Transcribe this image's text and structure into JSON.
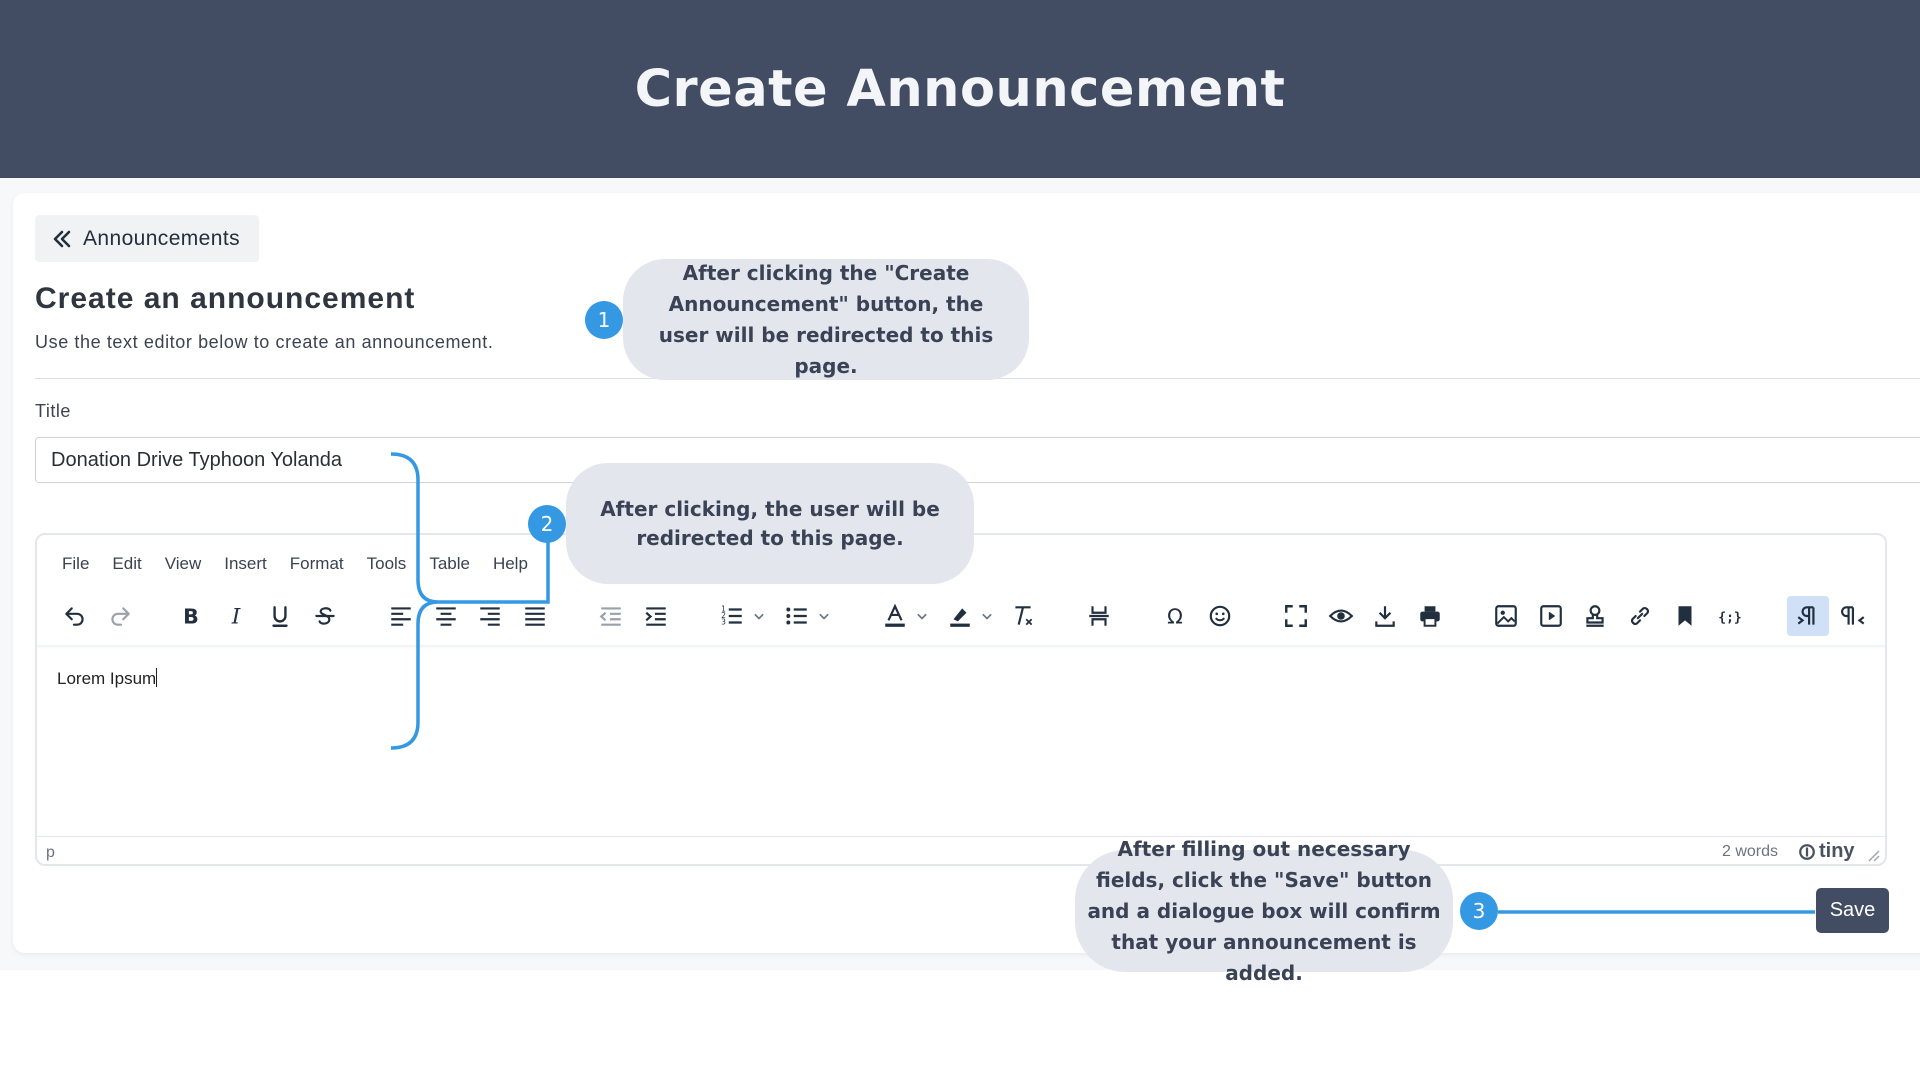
{
  "banner": {
    "title": "Create Announcement"
  },
  "back_button": {
    "label": "Announcements",
    "icon": "double-chevron-left-icon"
  },
  "form": {
    "heading": "Create an announcement",
    "subtitle": "Use the text editor below to create an announcement.",
    "title_label": "Title",
    "title_value": "Donation Drive Typhoon Yolanda"
  },
  "editor": {
    "menu": [
      "File",
      "Edit",
      "View",
      "Insert",
      "Format",
      "Tools",
      "Table",
      "Help"
    ],
    "content": "Lorem Ipsum",
    "status_path": "p",
    "word_count": "2 words",
    "brand": "tiny"
  },
  "save_button": {
    "label": "Save"
  },
  "callouts": {
    "c1": {
      "number": "1",
      "text": "After clicking the \"Create Announcement\" button, the user will be redirected to this page."
    },
    "c2": {
      "number": "2",
      "text": "After clicking, the user will be redirected to this page."
    },
    "c3": {
      "number": "3",
      "text": "After filling out necessary fields, click the \"Save\" button and a dialogue box will confirm that your announcement is added."
    }
  },
  "colors": {
    "banner": "#424c63",
    "accent": "#3498e2",
    "callout_bg": "#e3e6ed",
    "save_button": "#424c63"
  }
}
